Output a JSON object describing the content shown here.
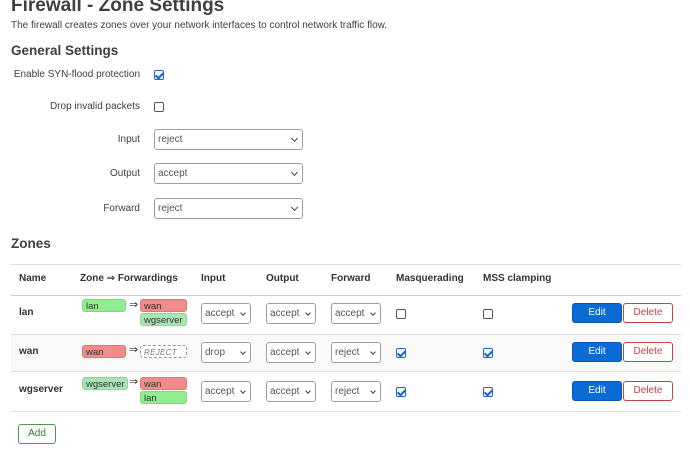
{
  "page": {
    "title": "Firewall - Zone Settings",
    "description": "The firewall creates zones over your network interfaces to control network traffic flow."
  },
  "general": {
    "title": "General Settings",
    "syn_flood_label": "Enable SYN-flood protection",
    "syn_flood_checked": true,
    "drop_invalid_label": "Drop invalid packets",
    "drop_invalid_checked": false,
    "input_label": "Input",
    "input_value": "reject",
    "output_label": "Output",
    "output_value": "accept",
    "forward_label": "Forward",
    "forward_value": "reject"
  },
  "zones": {
    "title": "Zones",
    "headers": {
      "name": "Name",
      "zone_forwardings": "Zone ⇒ Forwardings",
      "input": "Input",
      "output": "Output",
      "forward": "Forward",
      "masquerading": "Masquerading",
      "mss_clamping": "MSS clamping"
    },
    "rows": [
      {
        "name": "lan",
        "zone_badge": "lan",
        "arrow": "⇒",
        "forwards": [
          "wan",
          "wgserver"
        ],
        "input": "accept",
        "output": "accept",
        "forward": "accept",
        "masquerading": false,
        "mss_clamping": false,
        "edit_label": "Edit",
        "delete_label": "Delete"
      },
      {
        "name": "wan",
        "zone_badge": "wan",
        "arrow": "⇒",
        "forwards": [
          "REJECT"
        ],
        "input": "drop",
        "output": "accept",
        "forward": "reject",
        "masquerading": true,
        "mss_clamping": true,
        "edit_label": "Edit",
        "delete_label": "Delete"
      },
      {
        "name": "wgserver",
        "zone_badge": "wgserver",
        "arrow": "⇒",
        "forwards": [
          "wan",
          "lan"
        ],
        "input": "accept",
        "output": "accept",
        "forward": "reject",
        "masquerading": true,
        "mss_clamping": true,
        "edit_label": "Edit",
        "delete_label": "Delete"
      }
    ],
    "add_label": "Add"
  },
  "colors": {
    "zone_lan": "#90ee90",
    "zone_wan": "#f08c8c",
    "zone_wgserver": "#a8e4b4",
    "edit_button": "#0a6bd7",
    "delete_border": "#c44444",
    "add_border": "#4a9a4a",
    "checkbox_checked": "#1a63c9"
  },
  "icons": {
    "checkbox_checked": "checkmark-icon",
    "select_arrow": "chevron-down-icon"
  }
}
